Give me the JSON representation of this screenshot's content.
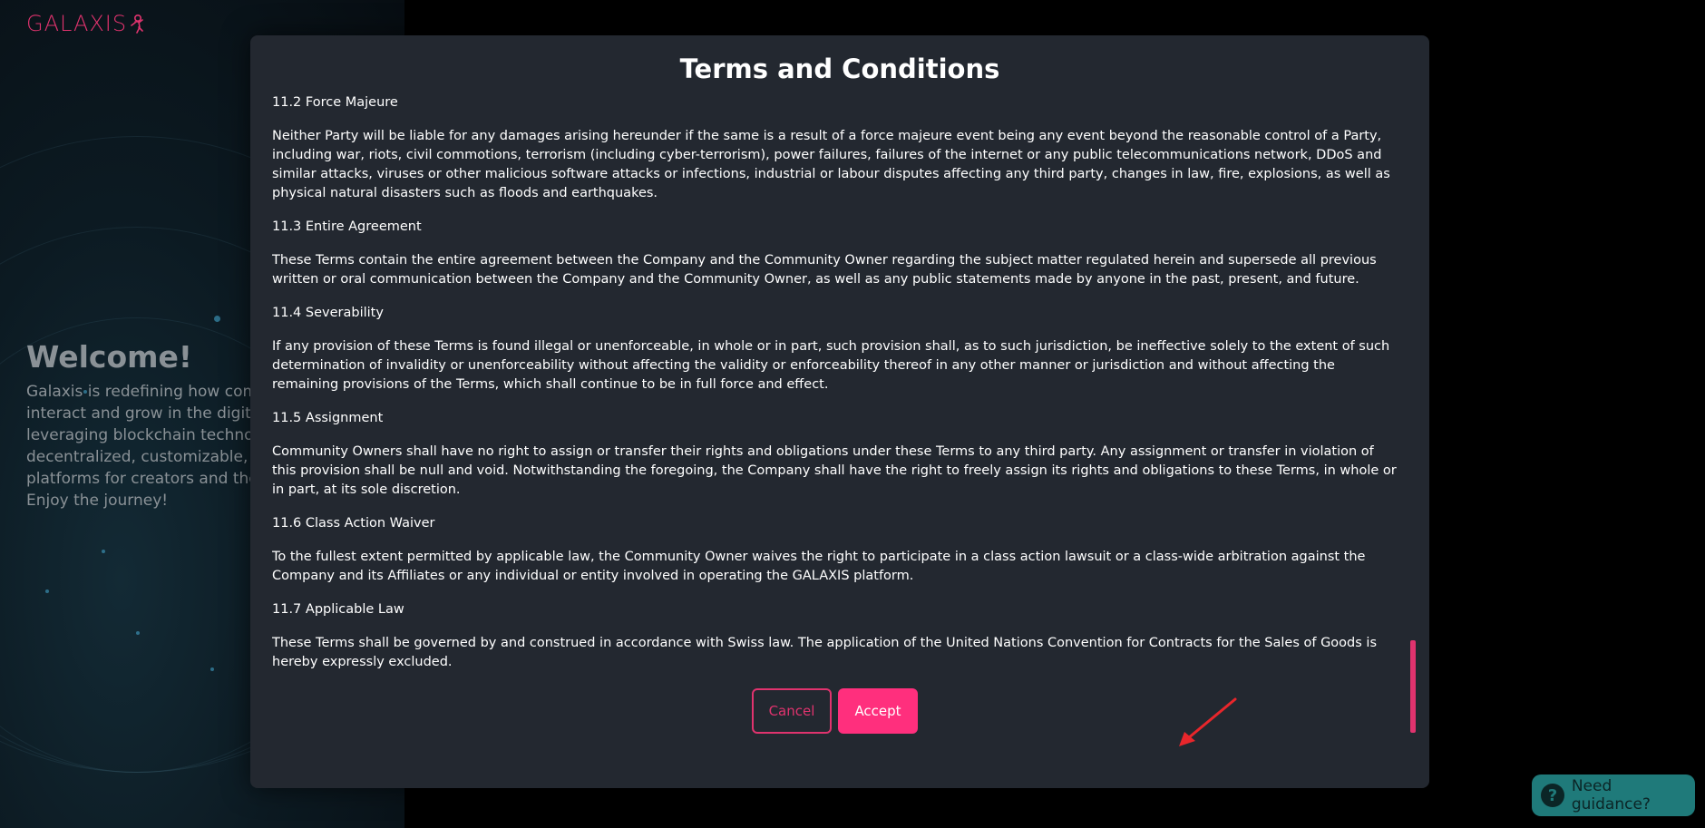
{
  "brand": {
    "logo_text": "GALAXIS",
    "accent_color": "#e0336e"
  },
  "welcome": {
    "title": "Welcome!",
    "text": "Galaxis is redefining how comm\ninteract and grow in the digital\nleveraging blockchain technolo\ndecentralized, customizable, ar\nplatforms for creators and their\nEnjoy the journey!"
  },
  "modal": {
    "title": "Terms and Conditions",
    "sections": [
      {
        "heading": "11.2 Force Majeure",
        "text": "Neither Party will be liable for any damages arising hereunder if the same is a result of a force majeure event being any event beyond the reasonable control of a Party, including war, riots, civil commotions, terrorism (including cyber-terrorism), power failures, failures of the internet or any public telecommunications network, DDoS and similar attacks, viruses or other malicious software attacks or infections, industrial or labour disputes affecting any third party, changes in law, fire, explosions, as well as physical natural disasters such as floods and earthquakes."
      },
      {
        "heading": "11.3 Entire Agreement",
        "text": "These Terms contain the entire agreement between the Company and the Community Owner regarding the subject matter regulated herein and supersede all previous written or oral communication between the Company and the Community Owner, as well as any public statements made by anyone in the past, present, and future."
      },
      {
        "heading": "11.4 Severability",
        "text": "If any provision of these Terms is found illegal or unenforceable, in whole or in part, such provision shall, as to such jurisdiction, be ineffective solely to the extent of such determination of invalidity or unenforceability without affecting the validity or enforceability thereof in any other manner or jurisdiction and without affecting the remaining provisions of the Terms, which shall continue to be in full force and effect."
      },
      {
        "heading": "11.5 Assignment",
        "text": "Community Owners shall have no right to assign or transfer their rights and obligations under these Terms to any third party. Any assignment or transfer in violation of this provision shall be null and void. Notwithstanding the foregoing, the Company shall have the right to freely assign its rights and obligations to these Terms, in whole or in part, at its sole discretion."
      },
      {
        "heading": "11.6 Class Action Waiver",
        "text": "To the fullest extent permitted by applicable law, the Community Owner waives the right to participate in a class action lawsuit or a class-wide arbitration against the Company and its Affiliates or any individual or entity involved in operating the GALAXIS platform."
      },
      {
        "heading": "11.7 Applicable Law",
        "text": "These Terms shall be governed by and construed in accordance with Swiss law. The application of the United Nations Convention for Contracts for the Sales of Goods is hereby expressly excluded."
      }
    ],
    "cancel_label": "Cancel",
    "accept_label": "Accept"
  },
  "guidance": {
    "label": "Need guidance?",
    "icon": "question-icon",
    "icon_glyph": "?"
  }
}
